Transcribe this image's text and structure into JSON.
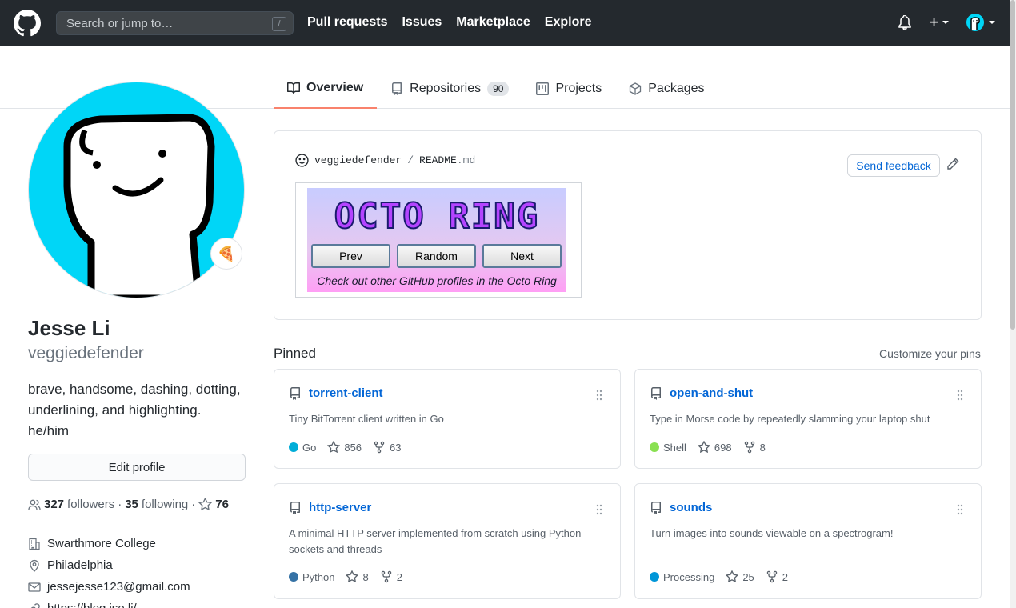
{
  "header": {
    "search_placeholder": "Search or jump to…",
    "search_shortcut": "/",
    "nav": [
      "Pull requests",
      "Issues",
      "Marketplace",
      "Explore"
    ],
    "plus_label": "+"
  },
  "tabs": [
    {
      "label": "Overview",
      "icon": "book-icon",
      "active": true
    },
    {
      "label": "Repositories",
      "icon": "repo-icon",
      "count": "90"
    },
    {
      "label": "Projects",
      "icon": "project-icon"
    },
    {
      "label": "Packages",
      "icon": "package-icon"
    }
  ],
  "profile": {
    "status_emoji": "🍕",
    "name": "Jesse Li",
    "username": "veggiedefender",
    "bio_line1": "brave, handsome, dashing, dotting, underlining, and highlighting.",
    "bio_line2": "he/him",
    "edit_label": "Edit profile",
    "followers": "327",
    "followers_label": "followers",
    "following": "35",
    "following_label": "following",
    "stars": "76",
    "sep": "·",
    "organization": "Swarthmore College",
    "location": "Philadelphia",
    "email": "jessejesse123@gmail.com",
    "website": "https://blog.jse.li/"
  },
  "readme": {
    "owner": "veggiedefender",
    "slash": "/",
    "file": "README",
    "ext": ".md",
    "feedback_label": "Send feedback",
    "banner_title": "OCTO RING",
    "buttons": [
      "Prev",
      "Random",
      "Next"
    ],
    "banner_link": "Check out other GitHub profiles in the Octo Ring"
  },
  "pinned": {
    "title": "Pinned",
    "customize": "Customize your pins",
    "repos": [
      {
        "name": "torrent-client",
        "desc": "Tiny BitTorrent client written in Go",
        "lang": "Go",
        "lang_color": "#00ADD8",
        "stars": "856",
        "forks": "63"
      },
      {
        "name": "open-and-shut",
        "desc": "Type in Morse code by repeatedly slamming your laptop shut",
        "lang": "Shell",
        "lang_color": "#89e051",
        "stars": "698",
        "forks": "8"
      },
      {
        "name": "http-server",
        "desc": "A minimal HTTP server implemented from scratch using Python sockets and threads",
        "lang": "Python",
        "lang_color": "#3572A5",
        "stars": "8",
        "forks": "2"
      },
      {
        "name": "sounds",
        "desc": "Turn images into sounds viewable on a spectrogram!",
        "lang": "Processing",
        "lang_color": "#0096D8",
        "stars": "25",
        "forks": "2"
      }
    ]
  }
}
